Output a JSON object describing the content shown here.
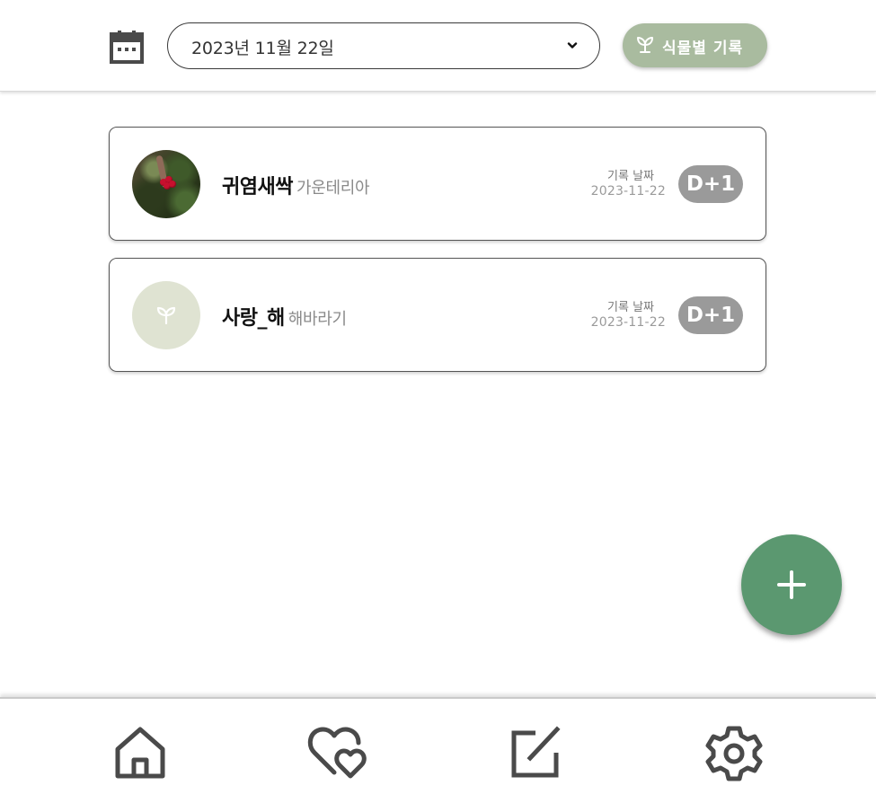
{
  "header": {
    "calendar_icon": "calendar-icon",
    "selected_date": "2023년 11월 22일",
    "plant_records_button": "식물별 기록",
    "plant_button_icon": "sprout-icon"
  },
  "records": [
    {
      "name": "귀염새싹",
      "species": "가운테리아",
      "record_label": "기록 날짜",
      "record_date": "2023-11-22",
      "dday": "D+1",
      "avatar": "photo"
    },
    {
      "name": "사랑_해",
      "species": "해바라기",
      "record_label": "기록 날짜",
      "record_date": "2023-11-22",
      "dday": "D+1",
      "avatar": "sprout-placeholder"
    }
  ],
  "fab": {
    "icon": "plus-icon"
  },
  "bottom_nav": [
    {
      "icon": "home-icon"
    },
    {
      "icon": "heart-icon"
    },
    {
      "icon": "edit-icon"
    },
    {
      "icon": "gear-icon"
    }
  ],
  "colors": {
    "accent_green": "#5b9870",
    "button_sage": "#a9bb9f",
    "badge_gray": "#9a9a9a",
    "placeholder_bg": "#dfe3d2",
    "icon_gray": "#4a4a4a"
  }
}
